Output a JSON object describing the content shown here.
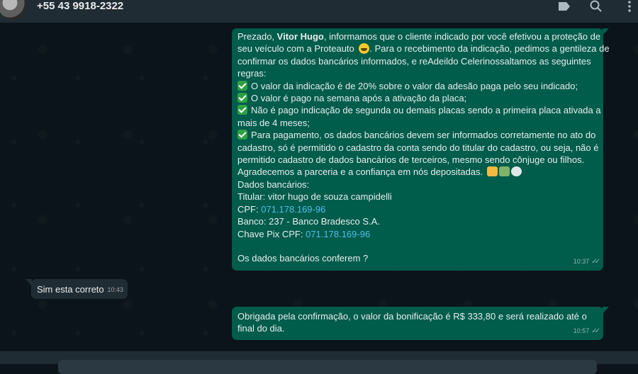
{
  "header": {
    "contact_name": "+55 43 9918-2322",
    "icons": [
      "tag-icon",
      "search-icon",
      "menu-icon"
    ]
  },
  "messages": [
    {
      "direction": "outgoing",
      "time": "10:37",
      "status": "read",
      "greeting_prefix": "Prezado, ",
      "greeting_name": "Vitor Hugo",
      "greeting_suffix": ", informamos que o cliente indicado por você efetivou a proteção de",
      "line2": "seu veículo com a Proteauto",
      "line2b": ". Para o recebimento da indicação, pedimos a gentileza de",
      "line3": "confirmar os dados bancários informados, e reAdeildo Celerinossaltamos as seguintes",
      "line4": "regras:",
      "rule1": "O valor da indicação é de 20% sobre o valor da adesão paga pelo seu indicado;",
      "rule2": "O valor é pago na semana após a ativação da placa;",
      "rule3a": "Não é pago indicação de segunda ou demais placas sendo a primeira placa ativada a",
      "rule3b": "mais de 4 meses;",
      "rule4a": "Para pagamento, os dados bancários devem ser informados corretamente no ato do",
      "rule4b": "cadastro, só é permitido o cadastro da conta sendo do titular do cadastro, ou seja, não é",
      "rule4c": "permitido cadastro de dados bancários de terceiros, mesmo sendo cônjuge ou filhos.",
      "thanks": "Agradecemos a parceria e a confiança em nós depositadas.",
      "bank_header": "Dados bancários:",
      "holder": "Titular: vitor hugo de souza campidelli",
      "cpf_label": "CPF: ",
      "cpf_value": "071.178.169-96",
      "bank": "Banco: 237 - Banco Bradesco S.A.",
      "pix_label": "Chave Pix CPF: ",
      "pix_value": "071.178.169-96",
      "question": "Os dados bancários conferem ?"
    },
    {
      "direction": "incoming",
      "text": "Sim esta correto",
      "time": "10:43"
    },
    {
      "direction": "outgoing",
      "text_line1": "Obrigada pela confirmação, o valor da bonificação é R$ 333,80 e será realizado até o",
      "text_line2": "final do dia.",
      "time": "10:57",
      "status": "read"
    }
  ],
  "colors": {
    "chat_background": "#0b141a",
    "header": "#202c33",
    "outgoing_bubble": "#005c4b",
    "incoming_bubble": "#202c33",
    "link": "#53bdeb"
  }
}
